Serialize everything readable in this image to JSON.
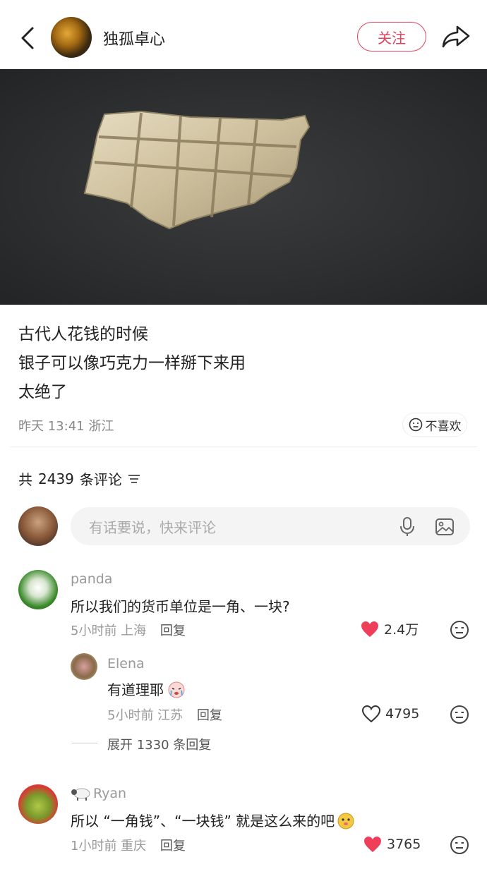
{
  "header": {
    "author_name": "独孤卓心",
    "follow_label": "关注"
  },
  "post": {
    "lines": [
      "古代人花钱的时候",
      "银子可以像巧克力一样掰下来用",
      "太绝了"
    ],
    "meta": "昨天 13:41 浙江",
    "dislike_label": "不喜欢"
  },
  "comments_header": {
    "prefix": "共",
    "count": "2439",
    "suffix": "条评论"
  },
  "comment_input": {
    "placeholder": "有话要说，快来评论"
  },
  "comments": [
    {
      "username": "panda",
      "text": "所以我们的货币单位是一角、一块?",
      "time_location": "5小时前 上海",
      "reply_label": "回复",
      "likes": "2.4万",
      "liked": true,
      "replies": [
        {
          "username": "Elena",
          "text": "有道理耶",
          "time_location": "5小时前 江苏",
          "reply_label": "回复",
          "likes": "4795",
          "liked": false
        }
      ],
      "expand_label": "展开 1330 条回复"
    },
    {
      "username": "Ryan",
      "text": "所以 “一角钱”、“一块钱” 就是这么来的吧",
      "time_location": "1小时前 重庆",
      "reply_label": "回复",
      "likes": "3765",
      "liked": true
    }
  ],
  "colors": {
    "accent": "#e0435b",
    "like_red": "#ef3e5a",
    "muted": "#999999"
  }
}
